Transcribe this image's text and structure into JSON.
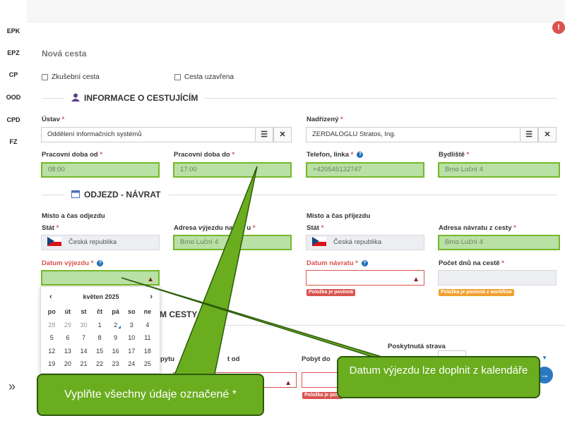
{
  "sidebar": {
    "items": [
      "EPK",
      "EPZ",
      "CP",
      "OOD",
      "CPD",
      "FZ"
    ],
    "expand_icon": "»"
  },
  "alert_icon": "!",
  "page_title": "Nová cesta",
  "checkboxes": {
    "test_trip": "Zkušební cesta",
    "closed_trip": "Cesta uzavřena"
  },
  "sections": {
    "traveler": "INFORMACE O CESTUJÍCÍM",
    "departure": "ODJEZD - NÁVRAT",
    "partial": "M CESTY"
  },
  "fields": {
    "ustav": {
      "label": "Ústav",
      "value": "Oddělení informačních systémů"
    },
    "nadrizeny": {
      "label": "Nadřízený",
      "value": "ZERDALOGLU Stratos, Ing."
    },
    "pracovni_od": {
      "label": "Pracovní doba od",
      "value": "08:00"
    },
    "pracovni_do": {
      "label": "Pracovní doba do",
      "value": "17:00"
    },
    "telefon": {
      "label": "Telefon, linka",
      "value": "+420545132747"
    },
    "bydliste": {
      "label": "Bydliště",
      "value": "Brno Luční 4"
    },
    "misto_odjezdu": "Místo a čas odjezdu",
    "misto_prijezdu": "Místo a čas příjezdu",
    "stat_odjezd": {
      "label": "Stát",
      "value": "Česká republika"
    },
    "adresa_vyjezdu": {
      "label": "Adresa výjezdu na",
      "label_end": "u",
      "value": "Brno Luční 4"
    },
    "stat_prijezd": {
      "label": "Stát",
      "value": "Česká republika"
    },
    "adresa_navratu": {
      "label": "Adresa návratu z cesty",
      "value": "Brno Luční 4"
    },
    "datum_vyjezdu": {
      "label": "Datum výjezdu"
    },
    "datum_navratu": {
      "label": "Datum návratu",
      "badge": "Položka je povinná"
    },
    "pocet_dnu": {
      "label": "Počet dnů na cestě",
      "badge": "Položka je povinná z workflow"
    },
    "poskytnuta_strava": "Poskytnutá strava",
    "pobyt_od": "t od",
    "pobyt_do": "Pobyt do",
    "pobyt_left": "pytu",
    "pobyt_do_badge": "Položka je povi"
  },
  "calendar": {
    "month": "květen 2025",
    "prev": "‹",
    "next": "›",
    "days_of_week": [
      "po",
      "út",
      "st",
      "čt",
      "pá",
      "so",
      "ne"
    ],
    "weeks": [
      [
        "28",
        "29",
        "30",
        "1",
        "2",
        "3",
        "4"
      ],
      [
        "5",
        "6",
        "7",
        "8",
        "9",
        "10",
        "11"
      ],
      [
        "12",
        "13",
        "14",
        "15",
        "16",
        "17",
        "18"
      ],
      [
        "19",
        "20",
        "21",
        "22",
        "23",
        "24",
        "25"
      ]
    ]
  },
  "callouts": {
    "left": "Vyplňte všechny údaje označené *",
    "right": "Datum výjezdu lze doplnit z kalendáře"
  },
  "colors": {
    "green_fill": "#b9e0a5",
    "green_border": "#76b82a",
    "error_red": "#d9534f",
    "callout_green": "#6aad1f",
    "link_blue": "#2a78c2"
  }
}
